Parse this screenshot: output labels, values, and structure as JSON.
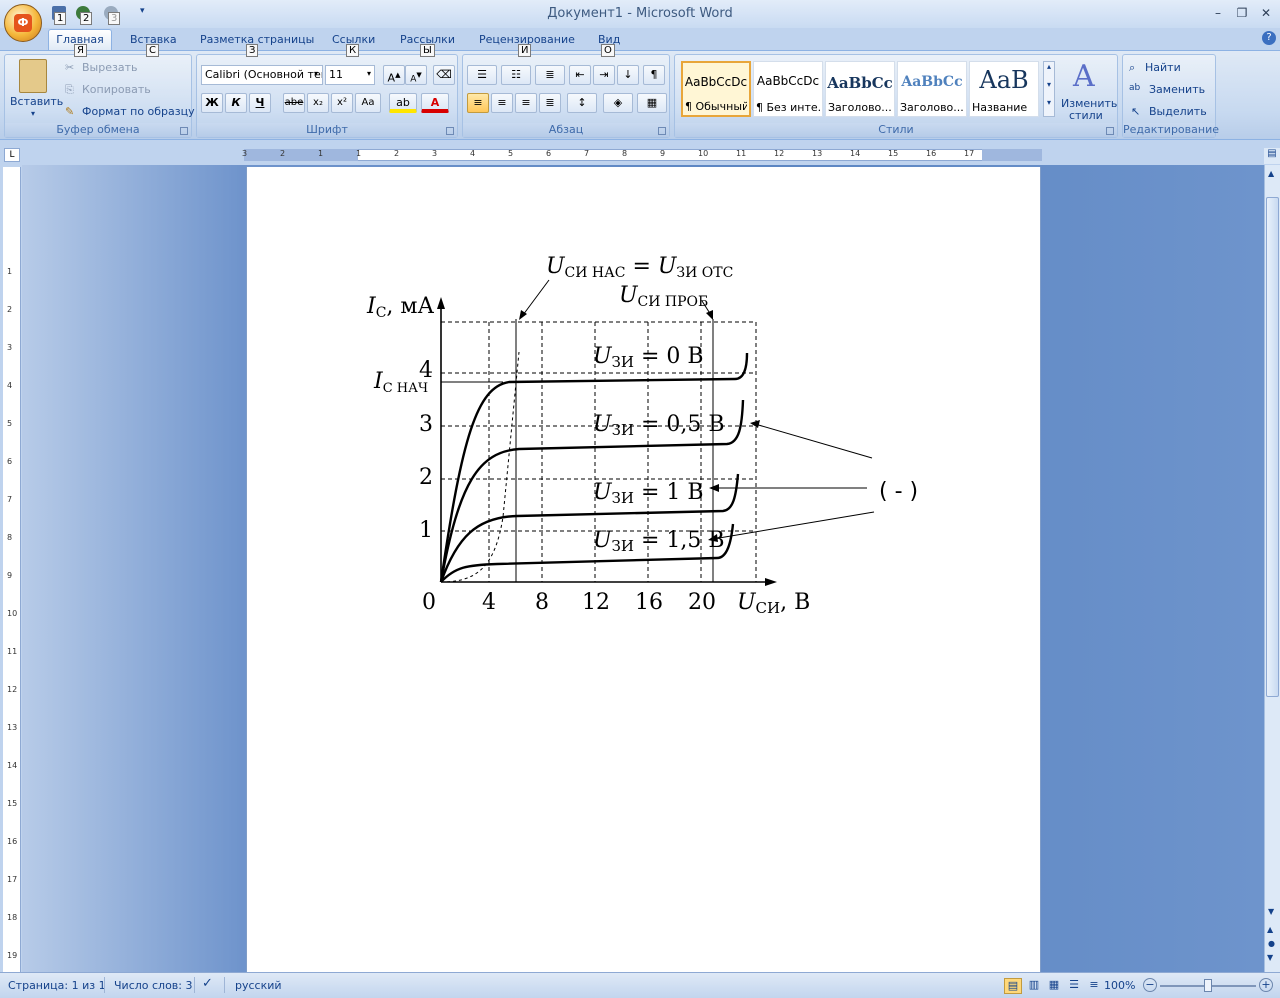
{
  "window": {
    "title": "Документ1 - Microsoft Word"
  },
  "qat": {
    "keytips": [
      "1",
      "2",
      "3"
    ]
  },
  "tabs": [
    {
      "label": "Главная",
      "keytip": "Я"
    },
    {
      "label": "Вставка",
      "keytip": "С"
    },
    {
      "label": "Разметка страницы",
      "keytip": "З"
    },
    {
      "label": "Ссылки",
      "keytip": "К"
    },
    {
      "label": "Рассылки",
      "keytip": "Ы"
    },
    {
      "label": "Рецензирование",
      "keytip": "И"
    },
    {
      "label": "Вид",
      "keytip": "О"
    }
  ],
  "clipboard": {
    "group": "Буфер обмена",
    "paste": "Вставить",
    "cut": "Вырезать",
    "copy": "Копировать",
    "format_painter": "Формат по образцу"
  },
  "font": {
    "group": "Шрифт",
    "name": "Calibri (Основной текст)",
    "size": "11",
    "bold": "Ж",
    "italic": "К",
    "underline": "Ч",
    "strike": "abe",
    "sub": "x₂",
    "sup": "x²",
    "case": "Aa"
  },
  "paragraph": {
    "group": "Абзац"
  },
  "styles": {
    "group": "Стили",
    "items": [
      {
        "preview": "AaBbCcDc",
        "name": "¶ Обычный"
      },
      {
        "preview": "AaBbCcDc",
        "name": "¶ Без инте..."
      },
      {
        "preview": "AaBbCc",
        "name": "Заголово..."
      },
      {
        "preview": "AaBbCc",
        "name": "Заголово..."
      },
      {
        "preview": "AaB",
        "name": "Название"
      }
    ],
    "change_line1": "Изменить",
    "change_line2": "стили"
  },
  "editing": {
    "group": "Редактирование",
    "find": "Найти",
    "replace": "Заменить",
    "select": "Выделить"
  },
  "ruler": {
    "h_marks": [
      "3",
      "2",
      "1",
      "1",
      "2",
      "3",
      "4",
      "5",
      "6",
      "7",
      "8",
      "9",
      "10",
      "11",
      "12",
      "13",
      "14",
      "15",
      "16",
      "17"
    ],
    "v_marks": [
      "1",
      "2",
      "3",
      "4",
      "5",
      "6",
      "7",
      "8",
      "9",
      "10",
      "11",
      "12",
      "13",
      "14",
      "15",
      "16",
      "17",
      "18",
      "19"
    ]
  },
  "figure": {
    "label_usat_u": "U",
    "label_usat_sub": "СИ НАС",
    "label_eq": " = ",
    "label_uoff_u": "U",
    "label_uoff_sub": "ЗИ ОТС",
    "label_ubr_u": "U",
    "label_ubr_sub": "СИ ПРОБ",
    "label_ic_i": "I",
    "label_ic_sub": "С",
    "label_ic_unit": ", мА",
    "label_inach_i": "I",
    "label_inach_sub": "С НАЧ",
    "ytick_labels": [
      "1",
      "2",
      "3",
      "4"
    ],
    "xtick_labels": [
      "0",
      "4",
      "8",
      "12",
      "16",
      "20"
    ],
    "xlabel_u": "U",
    "xlabel_sub": "СИ",
    "xlabel_unit": ", В",
    "curve_labels": [
      {
        "u": "U",
        "sub": "ЗИ",
        "val": " = 0 В"
      },
      {
        "u": "U",
        "sub": "ЗИ",
        "val": " = 0,5 В"
      },
      {
        "u": "U",
        "sub": "ЗИ",
        "val": " = 1 В"
      },
      {
        "u": "U",
        "sub": "ЗИ",
        "val": " = 1,5 В"
      }
    ],
    "callout": "( - )"
  },
  "status": {
    "page": "Страница: 1 из 1",
    "words": "Число слов: 3",
    "language": "русский",
    "zoom": "100%"
  }
}
